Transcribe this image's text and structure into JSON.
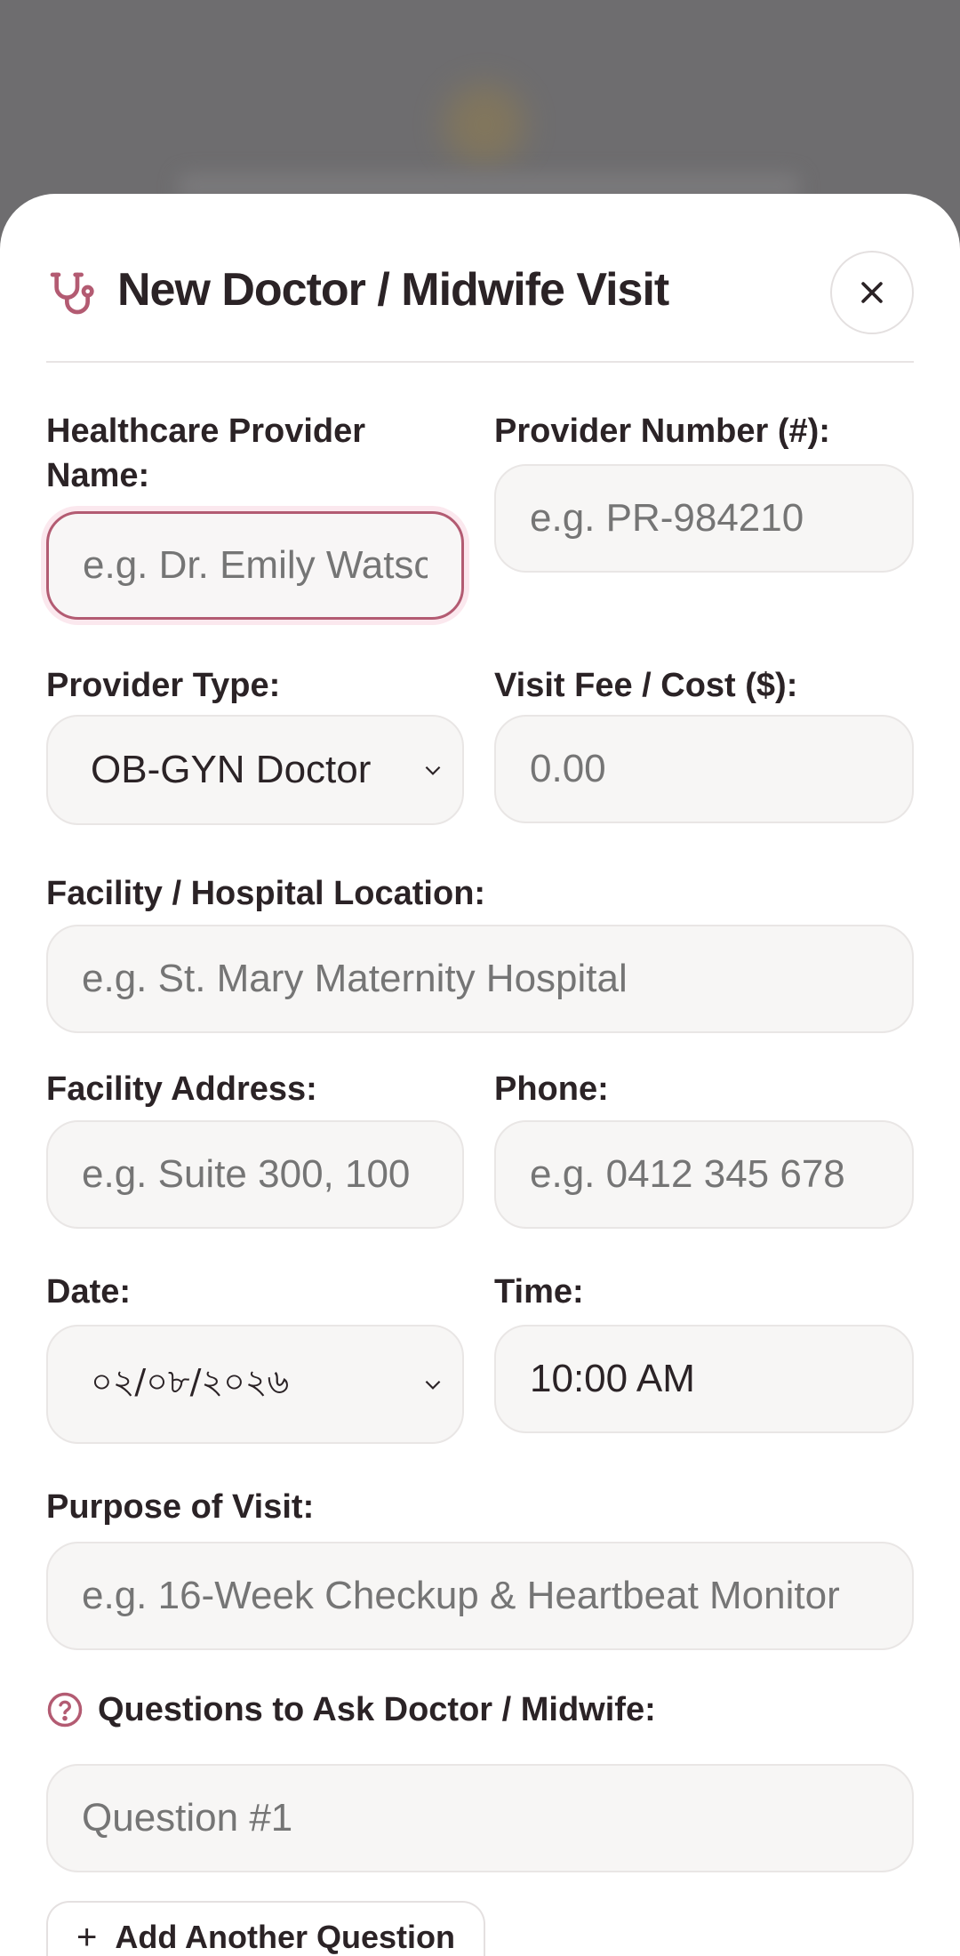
{
  "modal": {
    "title": "New Doctor / Midwife Visit",
    "close_icon": "close-icon",
    "header_icon": "stethoscope-icon"
  },
  "colors": {
    "accent": "#b35b72",
    "text": "#2b2326",
    "placeholder": "#a9a6a6",
    "input_bg": "#f7f6f5"
  },
  "fields": {
    "provider_name": {
      "label": "Healthcare Provider Name:",
      "placeholder": "e.g. Dr. Emily Watsc"
    },
    "provider_number": {
      "label": "Provider Number (#):",
      "placeholder": "e.g. PR-984210"
    },
    "provider_type": {
      "label": "Provider Type:",
      "value": "OB-GYN Doctor"
    },
    "visit_fee": {
      "label": "Visit Fee / Cost ($):",
      "placeholder": "0.00"
    },
    "facility": {
      "label": "Facility / Hospital Location:",
      "placeholder": "e.g. St. Mary Maternity Hospital"
    },
    "facility_address": {
      "label": "Facility Address:",
      "placeholder": "e.g. Suite 300, 100"
    },
    "phone": {
      "label": "Phone:",
      "placeholder": "e.g. 0412 345 678"
    },
    "date": {
      "label": "Date:",
      "value": "০২/০৮/২০২৬"
    },
    "time": {
      "label": "Time:",
      "value": "10:00 AM"
    },
    "purpose": {
      "label": "Purpose of Visit:",
      "placeholder": "e.g. 16-Week Checkup & Heartbeat Monitor"
    }
  },
  "questions": {
    "label": "Questions to Ask Doctor / Midwife:",
    "icon": "question-circle-icon",
    "items": [
      {
        "placeholder": "Question #1"
      }
    ],
    "add_label": "Add Another Question"
  }
}
